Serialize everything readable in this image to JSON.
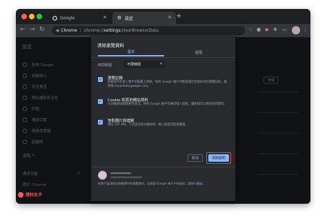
{
  "browser": {
    "tabs": [
      {
        "title": "Google",
        "icon": "google-favicon"
      },
      {
        "title": "設定",
        "icon": "gear-icon"
      }
    ],
    "omnibox": {
      "chip": "Chrome",
      "url_prefix": "chrome://",
      "url_bold": "settings",
      "url_suffix": "/clearBrowserData"
    }
  },
  "settings": {
    "heading": "設定",
    "sidebar": [
      {
        "label": "你與 Google"
      },
      {
        "label": "自動填入"
      },
      {
        "label": "安全檢查"
      },
      {
        "label": "隱私權和安全性"
      },
      {
        "label": "外觀"
      },
      {
        "label": "搜尋引擎"
      },
      {
        "label": "預設瀏覽器"
      },
      {
        "label": "起動時"
      },
      {
        "label": "進階"
      },
      {
        "label": "擴充功能"
      },
      {
        "label": "關於 Chrome"
      }
    ],
    "right_button": "管理"
  },
  "dialog": {
    "title": "清除瀏覽資料",
    "tabs": [
      "基本",
      "進階"
    ],
    "time_range_label": "時間範圍",
    "time_range_value": "不限時間",
    "options": [
      {
        "title": "瀏覽記錄",
        "desc_pre": "將會從所有登入帳戶的裝置上清除，你的 Google 帳戶可能會儲存其他形式的瀏覽記錄，請參閱 ",
        "desc_link": "myactivity.google.com",
        "desc_post": "。",
        "checked": true
      },
      {
        "title": "Cookie 和其他網站資料",
        "desc_pre": "大多數網站都會將你登出。你的 Google 帳戶仍維持登入狀態，讓系統可以清除同步資料。",
        "desc_link": "",
        "desc_post": "",
        "checked": true
      },
      {
        "title": "快取圖片和檔案",
        "desc_pre": "釋出 197 MB。下次造訪部分網站時，載入速度可能會變慢。",
        "desc_link": "",
        "desc_post": "",
        "checked": true
      }
    ],
    "cancel_label": "取消",
    "clear_label": "清除資料",
    "footer_pre": "如果只要清除這個裝置中的瀏覽資料，並保留 Google 帳戶中的資料，請執行",
    "footer_link": "登出",
    "footer_post": "。"
  },
  "watermark": "塔科女子"
}
